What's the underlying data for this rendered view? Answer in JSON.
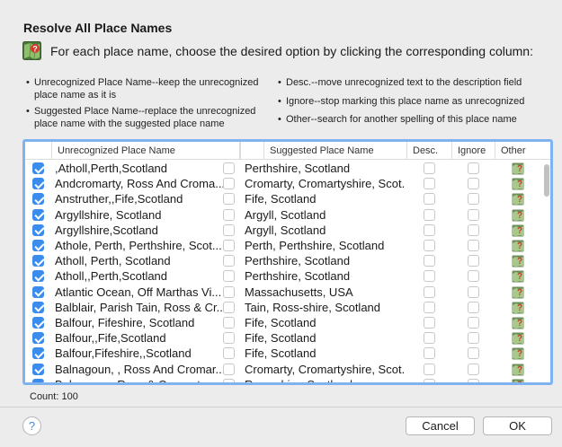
{
  "dialog": {
    "title": "Resolve All Place Names",
    "instruction": "For each place name, choose the desired option by clicking the corresponding column:",
    "bullets": {
      "b1": "Unrecognized Place Name--keep the unrecognized place name as it is",
      "b2": "Suggested Place Name--replace the unrecognized place name with the suggested place name",
      "b3": "Desc.--move unrecognized text to the description field",
      "b4": "Ignore--stop marking this place name as unrecognized",
      "b5": "Other--search for another spelling of this place name"
    },
    "bullet_glyph": "•"
  },
  "table": {
    "headers": [
      "Unrecognized Place Name",
      "Suggested Place Name",
      "Desc.",
      "Ignore",
      "Other"
    ],
    "rows": [
      {
        "keep": true,
        "unrecognized": ",Atholl,Perth,Scotland",
        "use_suggested": false,
        "suggested": "Perthshire, Scotland"
      },
      {
        "keep": true,
        "unrecognized": "Andcromarty, Ross And Croma...",
        "use_suggested": false,
        "suggested": "Cromarty, Cromartyshire, Scot..."
      },
      {
        "keep": true,
        "unrecognized": "Anstruther,,Fife,Scotland",
        "use_suggested": false,
        "suggested": "Fife, Scotland"
      },
      {
        "keep": true,
        "unrecognized": "Argyllshire, Scotland",
        "use_suggested": false,
        "suggested": "Argyll, Scotland"
      },
      {
        "keep": true,
        "unrecognized": "Argyllshire,Scotland",
        "use_suggested": false,
        "suggested": "Argyll, Scotland"
      },
      {
        "keep": true,
        "unrecognized": "Athole, Perth, Perthshire, Scot...",
        "use_suggested": false,
        "suggested": "Perth, Perthshire, Scotland"
      },
      {
        "keep": true,
        "unrecognized": "Atholl, Perth, Scotland",
        "use_suggested": false,
        "suggested": "Perthshire, Scotland"
      },
      {
        "keep": true,
        "unrecognized": "Atholl,,Perth,Scotland",
        "use_suggested": false,
        "suggested": "Perthshire, Scotland"
      },
      {
        "keep": true,
        "unrecognized": "Atlantic Ocean, Off Marthas Vi...",
        "use_suggested": false,
        "suggested": "Massachusetts, USA"
      },
      {
        "keep": true,
        "unrecognized": "Balblair, Parish Tain, Ross & Cr...",
        "use_suggested": false,
        "suggested": "Tain, Ross-shire, Scotland"
      },
      {
        "keep": true,
        "unrecognized": "Balfour, Fifeshire, Scotland",
        "use_suggested": false,
        "suggested": "Fife, Scotland"
      },
      {
        "keep": true,
        "unrecognized": "Balfour,,Fife,Scotland",
        "use_suggested": false,
        "suggested": "Fife, Scotland"
      },
      {
        "keep": true,
        "unrecognized": "Balfour,Fifeshire,,Scotland",
        "use_suggested": false,
        "suggested": "Fife, Scotland"
      },
      {
        "keep": true,
        "unrecognized": "Balnagoun, , Ross And Cromar...",
        "use_suggested": false,
        "suggested": "Cromarty, Cromartyshire, Scot..."
      },
      {
        "keep": true,
        "unrecognized": "Balnagoun, Ross & Cromarty",
        "use_suggested": false,
        "suggested": "Ross-shire, Scotland"
      }
    ]
  },
  "footer": {
    "count_label": "Count: 100",
    "help_label": "?",
    "cancel_label": "Cancel",
    "ok_label": "OK"
  },
  "colors": {
    "accent": "#3b8ced",
    "table_border": "#7fb3ef"
  },
  "icons": {
    "instruction": "map-question-icon",
    "other": "map-question-icon"
  }
}
